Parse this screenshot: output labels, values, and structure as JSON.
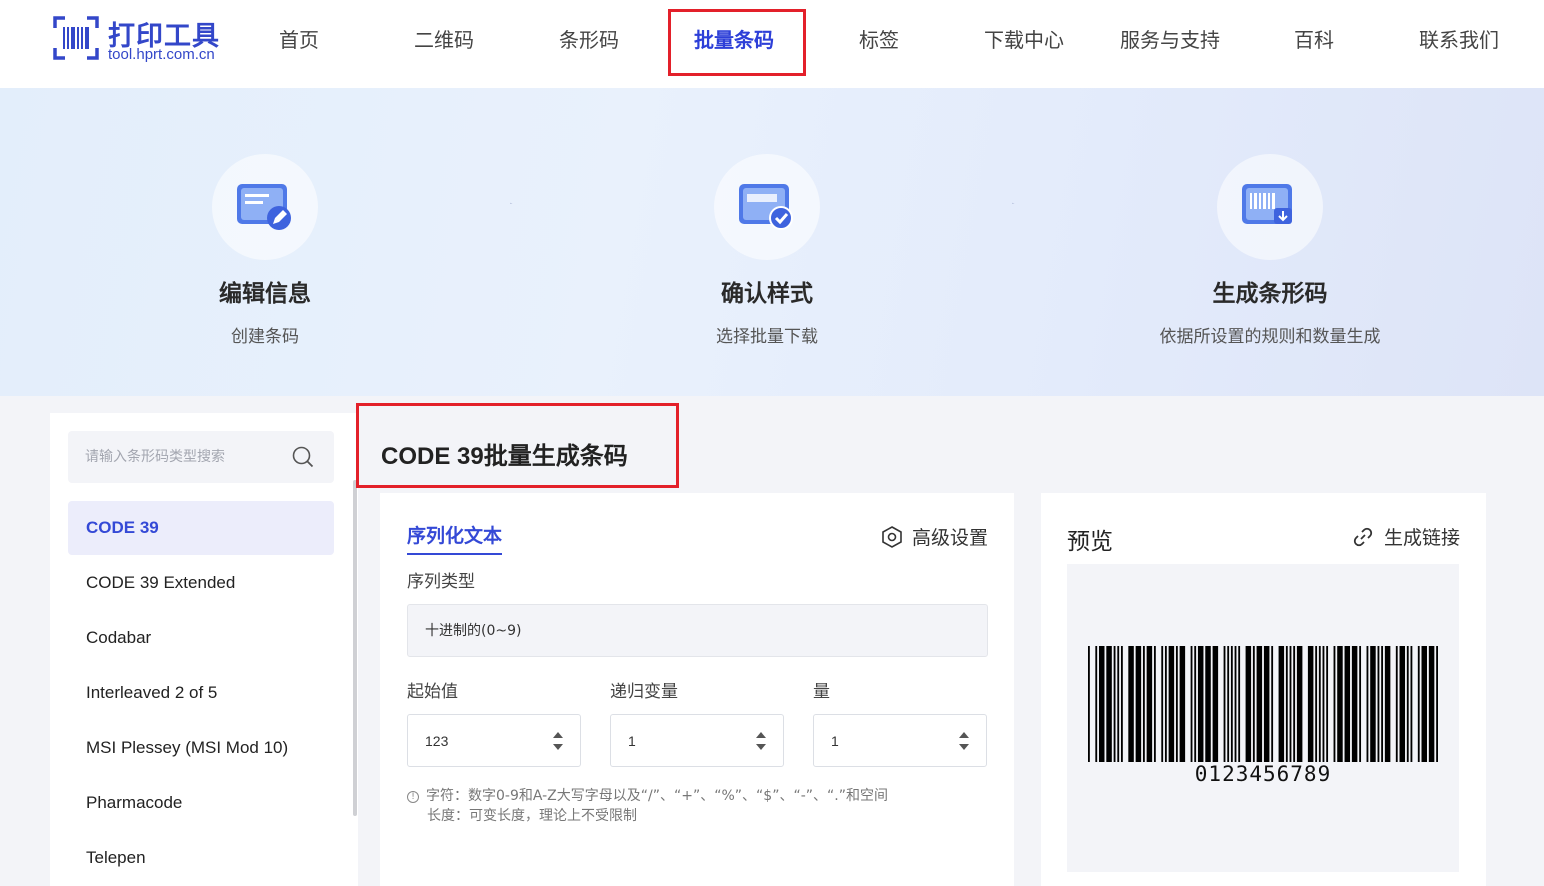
{
  "header": {
    "logo_title": "打印工具",
    "logo_sub": "tool.hprt.com.cn",
    "nav": [
      "首页",
      "二维码",
      "条形码",
      "批量条码",
      "标签",
      "下载中心",
      "服务与支持",
      "百科",
      "联系我们"
    ],
    "active_nav": "批量条码"
  },
  "banner": {
    "steps": [
      {
        "title": "编辑信息",
        "desc": "创建条码",
        "icon": "edit-form-icon"
      },
      {
        "title": "确认样式",
        "desc": "选择批量下载",
        "icon": "confirm-check-icon"
      },
      {
        "title": "生成条形码",
        "desc": "依据所设置的规则和数量生成",
        "icon": "barcode-download-icon"
      }
    ]
  },
  "sidebar": {
    "search_placeholder": "请输入条形码类型搜索",
    "items": [
      "CODE 39",
      "CODE 39 Extended",
      "Codabar",
      "Interleaved 2 of 5",
      "MSI Plessey (MSI Mod 10)",
      "Pharmacode",
      "Telepen"
    ],
    "active_item": "CODE 39"
  },
  "main": {
    "title": "CODE 39批量生成条码",
    "tab": "序列化文本",
    "advanced": "高级设置",
    "sequence_type_label": "序列类型",
    "sequence_type_value": "十进制的(0~9)",
    "start_label": "起始值",
    "start_value": "123",
    "step_label": "递归变量",
    "step_value": "1",
    "count_label": "量",
    "count_value": "1",
    "hint_chars": "字符：数字0-9和A-Z大写字母以及“/”、“+”、“%”、“$”、“-”、“.”和空间",
    "hint_length": "长度：可变长度，理论上不受限制"
  },
  "preview": {
    "title": "预览",
    "link": "生成链接",
    "barcode_text": "0123456789"
  },
  "colors": {
    "accent": "#3449d6",
    "highlight_red": "#e3202a",
    "page_bg": "#f3f4f8"
  }
}
